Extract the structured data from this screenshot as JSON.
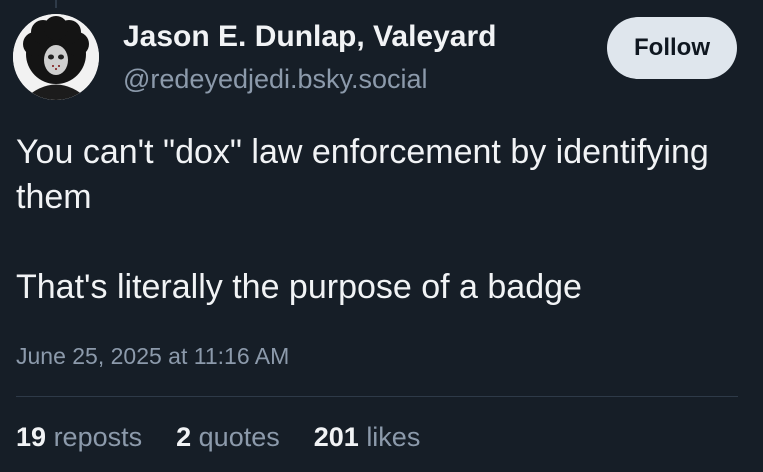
{
  "post": {
    "author_name": "Jason E. Dunlap, Valeyard",
    "author_handle": "@redeyedjedi.bsky.social",
    "follow_label": "Follow",
    "text_line_1": "You can't \"dox\" law enforcement by identifying them",
    "text_line_2": "That's literally the purpose of a badge",
    "timestamp": "June 25, 2025 at 11:16 AM",
    "stats": {
      "reposts_count": "19",
      "reposts_label": "reposts",
      "quotes_count": "2",
      "quotes_label": "quotes",
      "likes_count": "201",
      "likes_label": "likes"
    }
  },
  "colors": {
    "background": "#161e27",
    "primary_text": "#f1f3f5",
    "secondary_text": "#8c9aab",
    "follow_button_bg": "#dfe6ed"
  },
  "icons": {
    "avatar": "avatar-image"
  }
}
